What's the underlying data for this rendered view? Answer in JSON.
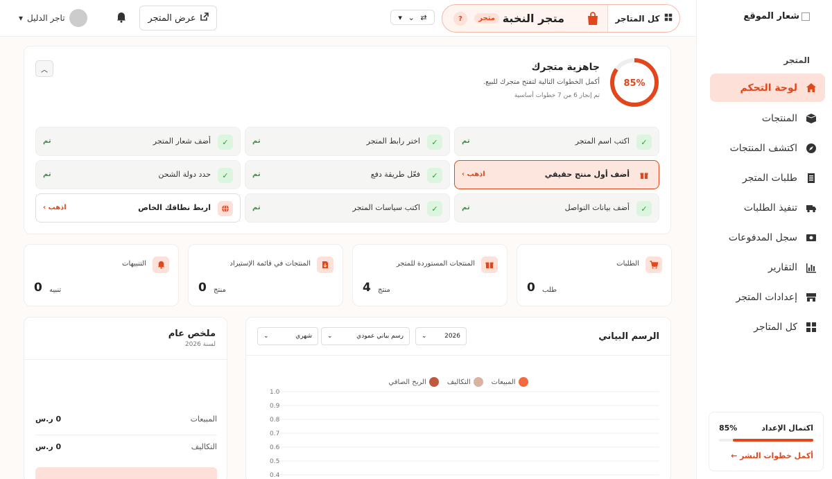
{
  "sidebar": {
    "logo_alt": "شعار الموقع",
    "section": "المتجر",
    "items": [
      {
        "label": "لوحة التحكم",
        "icon": "home-icon",
        "active": true
      },
      {
        "label": "المنتجات",
        "icon": "box-icon"
      },
      {
        "label": "اكتشف المنتجات",
        "icon": "compass-icon"
      },
      {
        "label": "طلبات المتجر",
        "icon": "receipt-icon"
      },
      {
        "label": "تنفيذ الطلبات",
        "icon": "truck-icon"
      },
      {
        "label": "سجل المدفوعات",
        "icon": "money-icon"
      },
      {
        "label": "التقارير",
        "icon": "chart-icon"
      },
      {
        "label": "إعدادات المتجر",
        "icon": "store-icon"
      },
      {
        "label": "كل المتاجر",
        "icon": "grid-icon"
      }
    ],
    "setup": {
      "title": "اكتمال الإعداد",
      "percent": "85%",
      "progress": 0.85,
      "link": "أكمل خطوات النشر ←"
    }
  },
  "topbar": {
    "all_stores": "كل المتاجر",
    "store_name": "متجر النخبة",
    "store_tag": "متجر",
    "help": "?",
    "view_store": "عرض المتجر",
    "user_name": "تاجر الدليل"
  },
  "readiness": {
    "percent": "85%",
    "progress": 0.85,
    "title": "جاهزية متجرك",
    "subtitle": "أكمل الخطوات التالية لتفتح متجرك للبيع.",
    "progress_text": "تم إنجاز 6 من 7 خطوات أساسية",
    "steps": [
      {
        "label": "اكتب اسم المتجر",
        "status": "تم"
      },
      {
        "label": "اختر رابط المتجر",
        "status": "تم"
      },
      {
        "label": "أضف شعار المتجر",
        "status": "تم"
      },
      {
        "label": "أضف أول منتج حقيقي",
        "status": "اذهب ›"
      },
      {
        "label": "فعّل طريقة دفع",
        "status": "تم"
      },
      {
        "label": "حدد دولة الشحن",
        "status": "تم"
      },
      {
        "label": "أضف بيانات التواصل",
        "status": "تم"
      },
      {
        "label": "اكتب سياسات المتجر",
        "status": "تم"
      },
      {
        "label": "اربط نطاقك الخاص",
        "status": "اذهب ›"
      }
    ]
  },
  "stats": [
    {
      "label": "الطلبات",
      "value": "0",
      "unit": "طلب",
      "icon": "cart-icon"
    },
    {
      "label": "المنتجات المستوردة للمتجر",
      "value": "4",
      "unit": "منتج",
      "icon": "gift-icon"
    },
    {
      "label": "المنتجات في قائمة الإستيراد",
      "value": "0",
      "unit": "منتج",
      "icon": "import-icon"
    },
    {
      "label": "التنبيهات",
      "value": "0",
      "unit": "تنبيه",
      "icon": "bell-icon"
    }
  ],
  "chart_card": {
    "title": "الرسم البياني",
    "year": "2026",
    "chart_type": "رسم بياني عمودي",
    "period": "شهري"
  },
  "chart_data": {
    "type": "bar",
    "series": [
      {
        "name": "المبيعات",
        "color": "#f26a3d",
        "values": []
      },
      {
        "name": "التكاليف",
        "color": "#d9b2a0",
        "values": []
      },
      {
        "name": "الربح الصافي",
        "color": "#c0583e",
        "values": []
      }
    ],
    "yticks": [
      "1.0",
      "0.9",
      "0.8",
      "0.7",
      "0.6",
      "0.5",
      "0.4"
    ],
    "ylim": [
      0,
      1
    ],
    "grid": true,
    "legend": "top-center"
  },
  "summary": {
    "title": "ملخص عام",
    "subtitle": "لسنة 2026",
    "rows": [
      {
        "label": "المبيعات",
        "value": "0 ر.س"
      },
      {
        "label": "التكاليف",
        "value": "0 ر.س"
      }
    ]
  }
}
